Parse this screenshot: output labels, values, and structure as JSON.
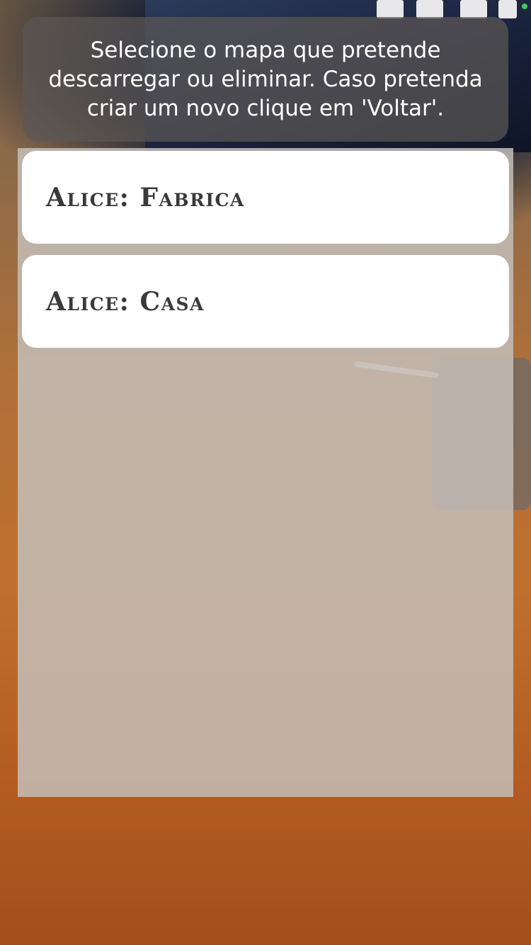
{
  "instruction": {
    "text": "Selecione o mapa que pretende descarregar ou eliminar. Caso pretenda criar um novo clique em 'Voltar'."
  },
  "maps": {
    "items": [
      {
        "label": "Alice: Fabrica"
      },
      {
        "label": "Alice: Casa"
      }
    ]
  },
  "colors": {
    "banner_bg": "#5c5854",
    "panel_bg": "#c4beb8",
    "item_bg": "#ffffff",
    "item_text": "#3a3a3a",
    "status_dot": "#3ccb5a"
  }
}
